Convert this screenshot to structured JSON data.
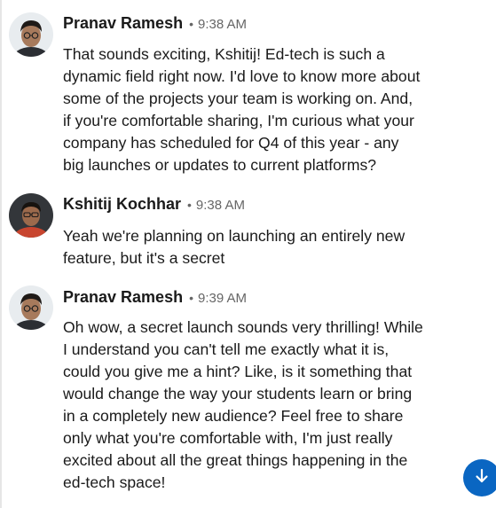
{
  "messages": [
    {
      "sender": "Pranav Ramesh",
      "separator": "•",
      "time": "9:38 AM",
      "lines": [
        "That sounds exciting, Kshitij! Ed-tech is such a",
        "dynamic field right now. I'd love to know more about",
        "some of the projects your team is working on. And,",
        "if you're comfortable sharing, I'm curious what your",
        "company has scheduled for Q4 of this year - any",
        "big launches or updates to current platforms?"
      ]
    },
    {
      "sender": "Kshitij Kochhar",
      "separator": "•",
      "time": "9:38 AM",
      "lines": [
        "Yeah we're planning on launching an entirely new",
        "feature, but it's a secret"
      ]
    },
    {
      "sender": "Pranav Ramesh",
      "separator": "•",
      "time": "9:39 AM",
      "lines": [
        "Oh wow, a secret launch sounds very thrilling! While",
        "I understand you can't tell me exactly what it is,",
        "could you give me a hint? Like, is it something that",
        "would change the way your students learn or bring",
        "in a completely new audience? Feel free to share",
        "only what you're comfortable with, I'm just really",
        "excited about all the great things happening in the",
        "ed-tech space!"
      ]
    }
  ],
  "scroll_button": {
    "icon": "arrow-down-icon"
  },
  "colors": {
    "accent": "#0a66c2",
    "timestamp": "#666666",
    "text": "#1a1a1a"
  }
}
